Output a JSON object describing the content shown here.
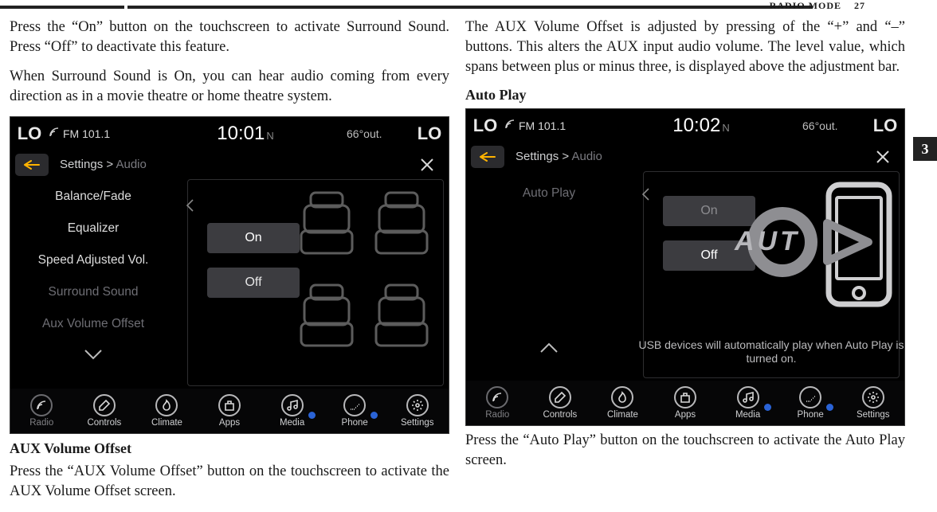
{
  "page_header": {
    "section": "RADIO MODE",
    "pagenum": "27",
    "sidetab": "3"
  },
  "left": {
    "p1": "Press the “On” button on the touchscreen to activate Surround Sound. Press “Off” to deactivate this feature.",
    "p2": "When Surround Sound is On, you can hear audio coming from every direction as in a movie theatre or home theatre system.",
    "subhead": "AUX Volume Offset",
    "p3": "Press the “AUX Volume Offset” button on the touchscreen to activate the AUX Volume Offset screen."
  },
  "right": {
    "p1": "The AUX Volume Offset is adjusted by pressing of the “+” and “–” buttons. This alters the AUX input audio volume. The level value, which spans between plus or minus three, is displayed above the adjustment bar.",
    "subhead": "Auto Play",
    "caption": "Press the “Auto Play” button on the touchscreen to activate the Auto Play screen."
  },
  "shot1": {
    "lo": "LO",
    "lo2": "LO",
    "fm": "FM 101.1",
    "time": "10:01",
    "time_sub": "N",
    "temp": "66°out.",
    "crumb_root": "Settings >",
    "crumb_leaf": "Audio",
    "side": [
      "Balance/Fade",
      "Equalizer",
      "Speed Adjusted Vol.",
      "Surround Sound",
      "Aux Volume Offset"
    ],
    "opt_on": "On",
    "opt_off": "Off",
    "bottom": [
      "Radio",
      "Controls",
      "Climate",
      "Apps",
      "Media",
      "Phone",
      "Settings"
    ]
  },
  "shot2": {
    "lo": "LO",
    "lo2": "LO",
    "fm": "FM 101.1",
    "time": "10:02",
    "time_sub": "N",
    "temp": "66°out.",
    "crumb_root": "Settings >",
    "crumb_leaf": "Audio",
    "side_top": "Auto Play",
    "opt_on": "On",
    "opt_off": "Off",
    "overlay_text": "AUT",
    "desc": "USB devices will automatically play when Auto Play is turned on.",
    "bottom": [
      "Radio",
      "Controls",
      "Climate",
      "Apps",
      "Media",
      "Phone",
      "Settings"
    ]
  }
}
